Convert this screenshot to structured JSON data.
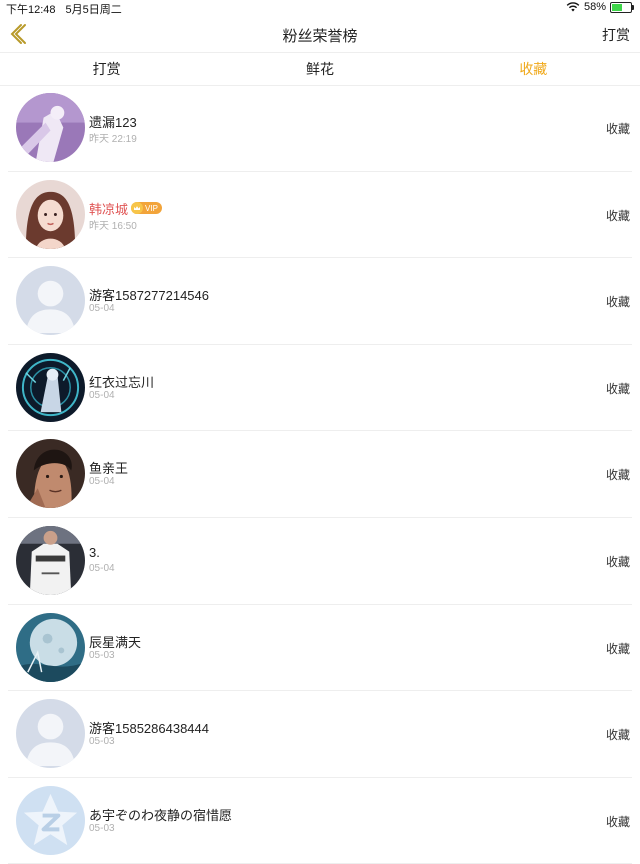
{
  "status_bar": {
    "time": "下午12:48",
    "date": "5月5日周二",
    "battery": "58%",
    "battery_level": 0.58
  },
  "nav": {
    "title": "粉丝荣誉榜",
    "right_action": "打赏"
  },
  "tabs": [
    {
      "label": "打赏",
      "active": false
    },
    {
      "label": "鲜花",
      "active": false
    },
    {
      "label": "收藏",
      "active": true
    }
  ],
  "colors": {
    "accent": "#f0a91b",
    "vip_name": "#e05555"
  },
  "fans": [
    {
      "name": "遗漏123",
      "time": "昨天 22:19",
      "action": "收藏",
      "avatar": "purple-photo-avatar"
    },
    {
      "name": "韩凉城",
      "vip": "VIP",
      "time": "昨天 16:50",
      "action": "收藏",
      "avatar": "woman-photo-avatar"
    },
    {
      "name": "游客1587277214546",
      "time": "05-04",
      "action": "收藏",
      "avatar": "default-user-avatar"
    },
    {
      "name": "红衣过忘川",
      "time": "05-04",
      "action": "收藏",
      "avatar": "anime-dark-avatar"
    },
    {
      "name": "鱼亲王",
      "time": "05-04",
      "action": "收藏",
      "avatar": "man-photo-avatar"
    },
    {
      "name": "3.",
      "time": "05-04",
      "action": "收藏",
      "avatar": "lonely-shirt-avatar"
    },
    {
      "name": "辰星满天",
      "time": "05-03",
      "action": "收藏",
      "avatar": "moon-art-avatar"
    },
    {
      "name": "游客1585286438444",
      "time": "05-03",
      "action": "收藏",
      "avatar": "default-user-avatar"
    },
    {
      "name": "あ宇ぞのわ夜静の宿惜愿",
      "time": "05-03",
      "action": "收藏",
      "avatar": "qq-logo-avatar"
    }
  ]
}
